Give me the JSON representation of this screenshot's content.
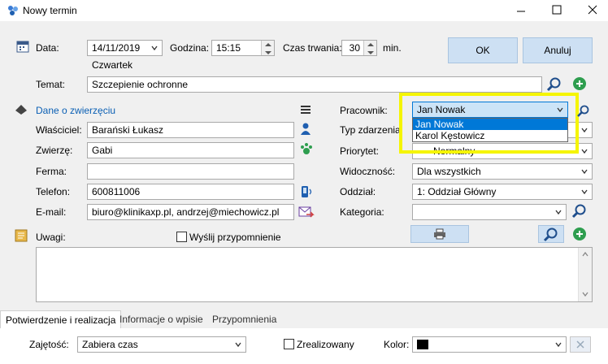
{
  "window": {
    "title": "Nowy termin",
    "icon": "app-icon",
    "controls": [
      "minimize-icon",
      "maximize-icon",
      "close-icon"
    ]
  },
  "header": {
    "date_label": "Data:",
    "date_value": "14/11/2019",
    "weekday": "Czwartek",
    "time_label": "Godzina:",
    "time_value": "15:15",
    "duration_label": "Czas trwania:",
    "duration_value": "30",
    "duration_unit": "min.",
    "ok_label": "OK",
    "cancel_label": "Anuluj"
  },
  "subject": {
    "label": "Temat:",
    "value": "Szczepienie ochronne"
  },
  "animal": {
    "section_label": "Dane o zwierzęciu",
    "owner_label": "Właściciel:",
    "owner_value": "Barański Łukasz",
    "animal_label": "Zwierzę:",
    "animal_value": "Gabi",
    "farm_label": "Ferma:",
    "farm_value": "",
    "phone_label": "Telefon:",
    "phone_value": "600811006",
    "email_label": "E-mail:",
    "email_value": "biuro@klinikaxp.pl, andrzej@miechowicz.pl"
  },
  "right": {
    "employee_label": "Pracownik:",
    "employee_value": "Jan Nowak",
    "employee_options": [
      "Jan Nowak",
      "Karol Kęstowicz"
    ],
    "event_type_label": "Typ zdarzenia:",
    "priority_label": "Priorytet:",
    "priority_value": "Normalny",
    "visibility_label": "Widoczność:",
    "visibility_value": "Dla wszystkich",
    "branch_label": "Oddział:",
    "branch_value": "1: Oddział Główny",
    "category_label": "Kategoria:",
    "category_value": ""
  },
  "notes": {
    "label": "Uwagi:",
    "reminder_label": "Wyślij przypomnienie",
    "reminder_checked": false,
    "value": ""
  },
  "tabs": [
    "Potwierdzenie i realizacja",
    "Informacje o wpisie",
    "Przypomnienia"
  ],
  "footer": {
    "busy_label": "Zajętość:",
    "busy_value": "Zabiera czas",
    "done_label": "Zrealizowany",
    "done_checked": false,
    "color_label": "Kolor:",
    "color_value": "#000000"
  },
  "colors": {
    "highlight": "#f5f500",
    "selection": "#0078d7",
    "accent_blue": "#0a5fb4",
    "button_blue": "#cde0f3",
    "green": "#2e9e4f"
  }
}
